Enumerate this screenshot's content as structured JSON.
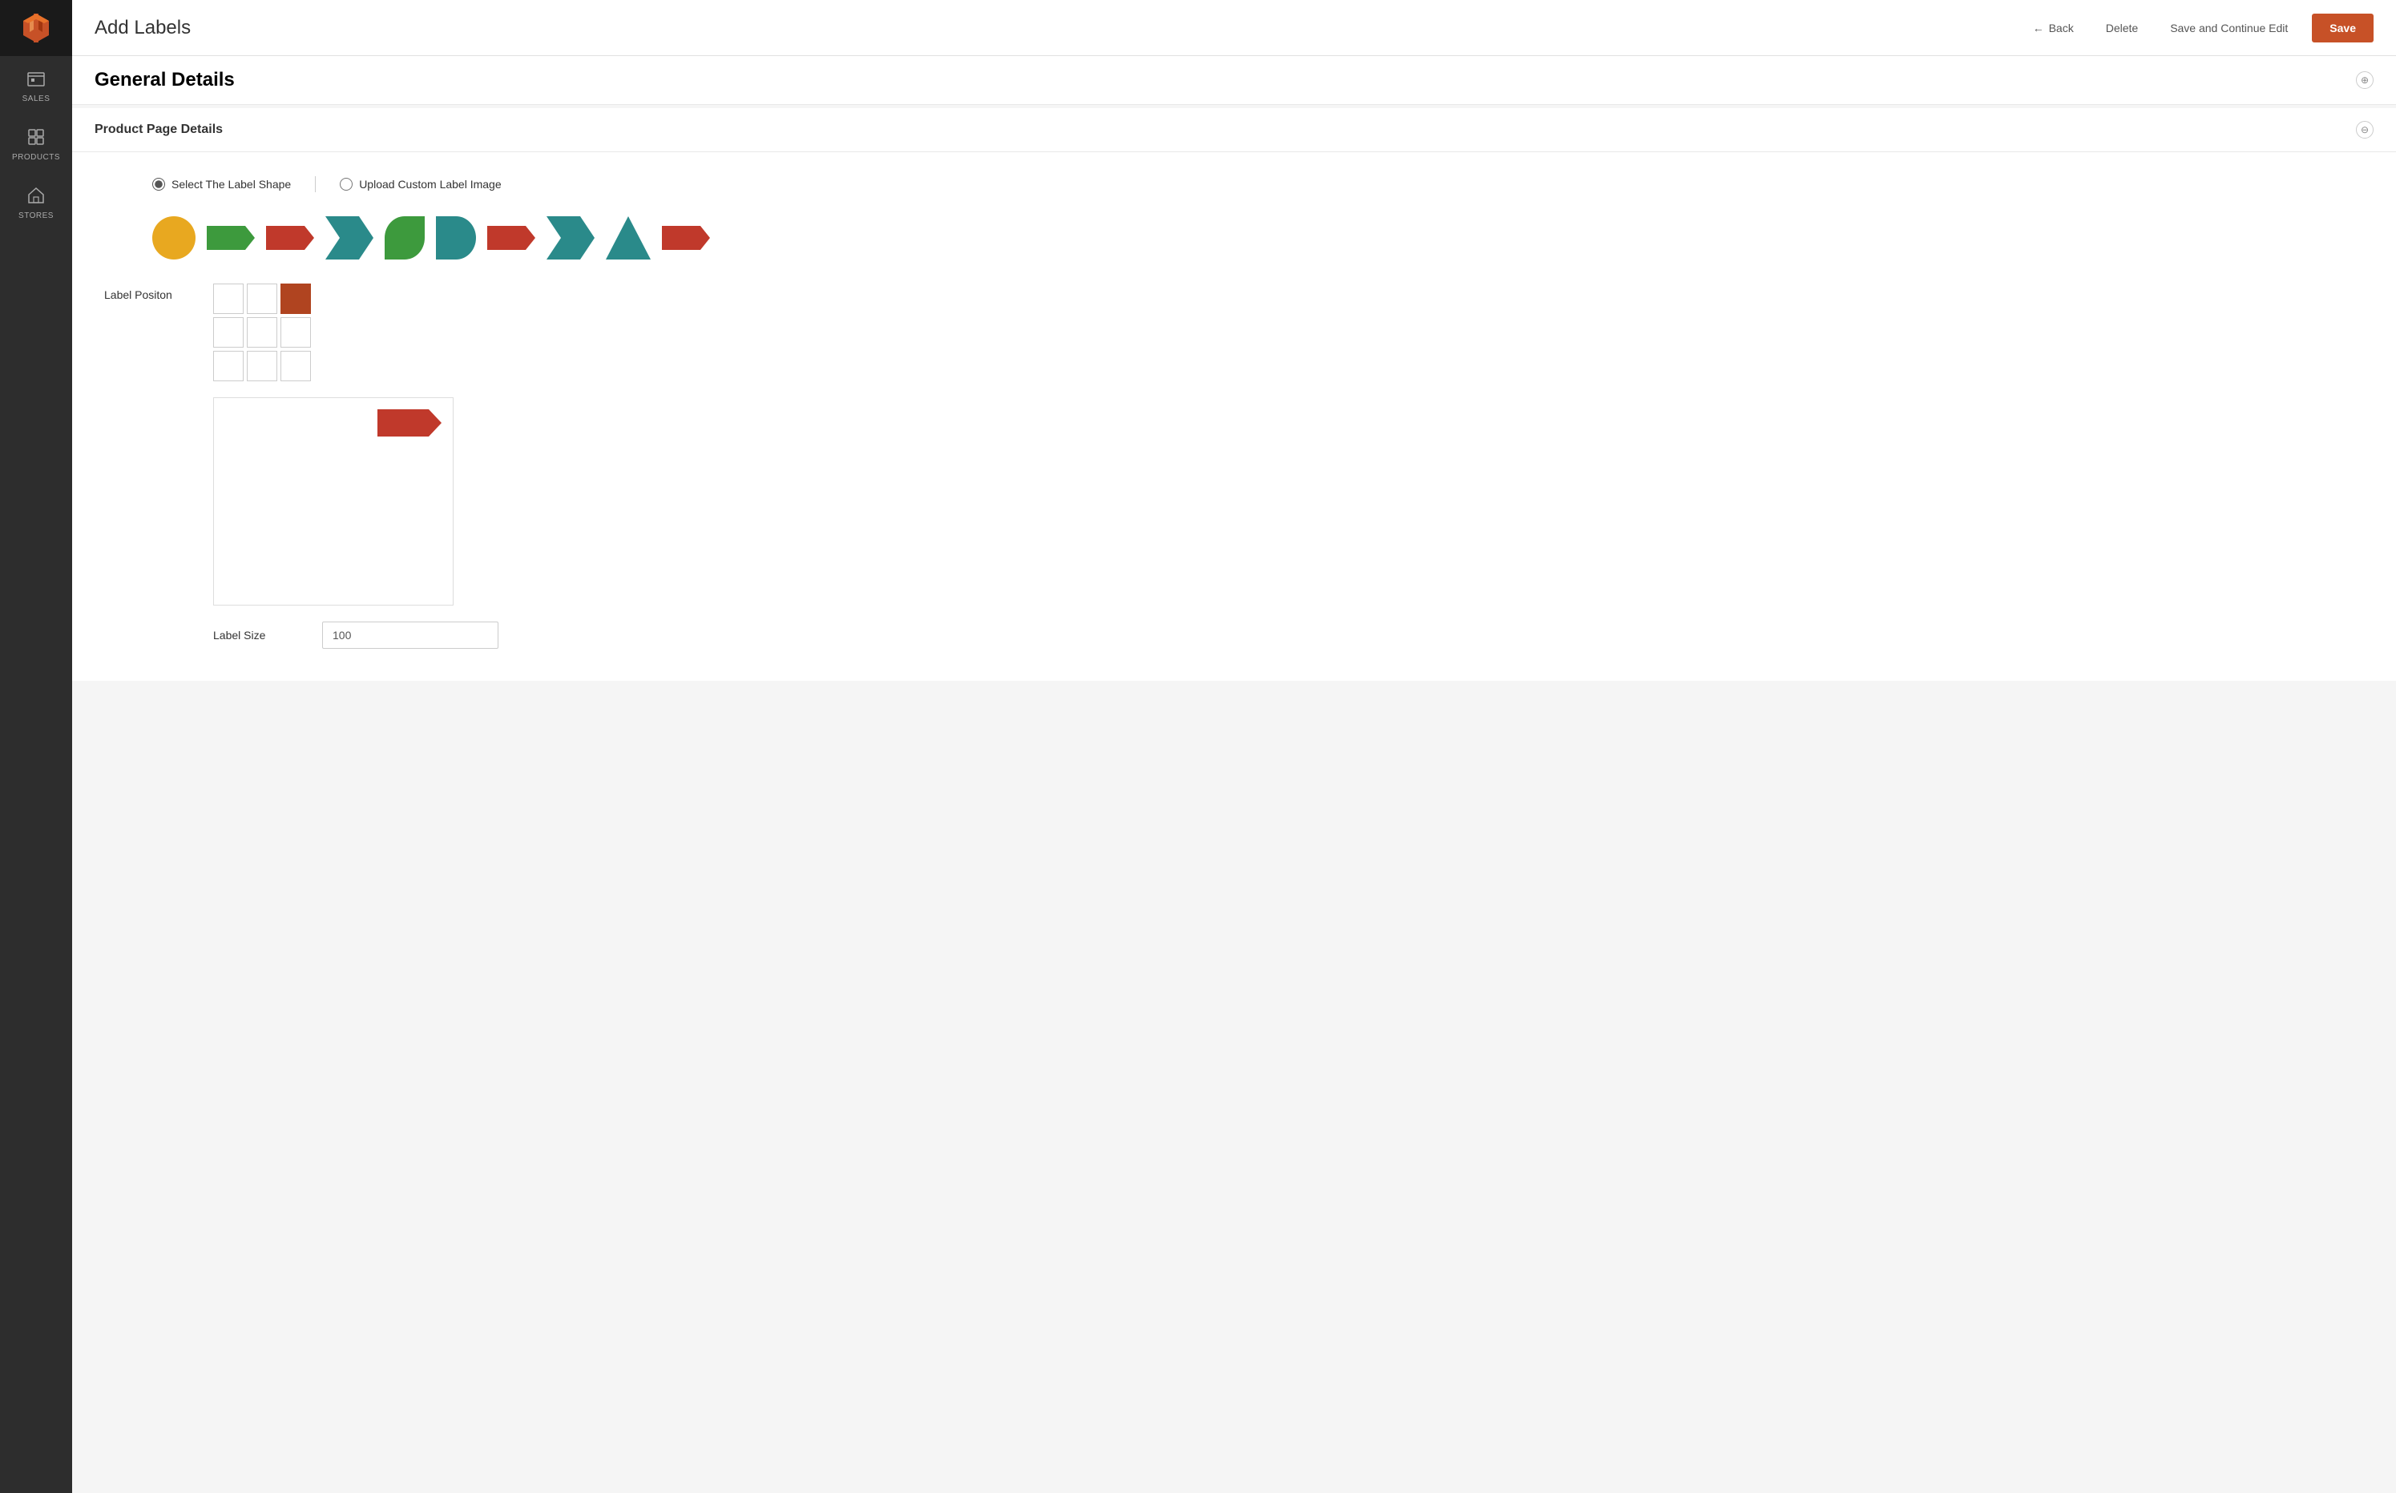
{
  "sidebar": {
    "logo_alt": "Magento Logo",
    "items": [
      {
        "id": "sales",
        "label": "SALES",
        "icon": "sales-icon"
      },
      {
        "id": "products",
        "label": "PRODUCTS",
        "icon": "products-icon"
      },
      {
        "id": "stores",
        "label": "STORES",
        "icon": "stores-icon"
      }
    ]
  },
  "header": {
    "title": "Add Labels",
    "back_label": "Back",
    "delete_label": "Delete",
    "save_continue_label": "Save and Continue Edit",
    "save_label": "Save"
  },
  "page": {
    "general_details_label": "General Details",
    "product_page_details_label": "Product Page Details",
    "radio_options": [
      {
        "id": "select-shape",
        "label": "Select The Label Shape",
        "checked": true
      },
      {
        "id": "upload-image",
        "label": "Upload Custom Label Image",
        "checked": false
      }
    ],
    "label_position_label": "Label Positon",
    "position_grid": [
      [
        false,
        false,
        true
      ],
      [
        false,
        false,
        false
      ],
      [
        false,
        false,
        false
      ]
    ],
    "label_size_label": "Label Size",
    "label_size_value": "100"
  }
}
